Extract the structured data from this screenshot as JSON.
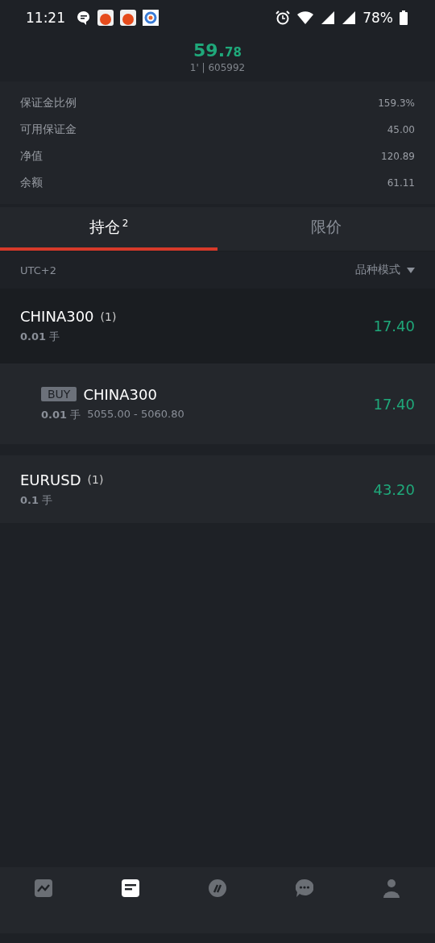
{
  "status_bar": {
    "time": "11:21",
    "battery": "78%"
  },
  "header": {
    "balance_whole": "59.",
    "balance_fraction": "78",
    "account": "1' | 605992"
  },
  "summary": [
    {
      "label": "保证金比例",
      "value": "159.3%"
    },
    {
      "label": "可用保证金",
      "value": "45.00"
    },
    {
      "label": "净值",
      "value": "120.89"
    },
    {
      "label": "余额",
      "value": "61.11"
    }
  ],
  "tabs": [
    {
      "label": "持仓",
      "count": "2",
      "selected": true
    },
    {
      "label": "限价",
      "selected": false
    }
  ],
  "toolbar": {
    "timezone": "UTC+2",
    "mode": "品种模式"
  },
  "positions": [
    {
      "kind": "group",
      "symbol": "CHINA300",
      "count": "(1)",
      "lots": "0.01",
      "unit": "手",
      "profit": "17.40"
    },
    {
      "kind": "order",
      "side": "BUY",
      "symbol": "CHINA300",
      "lots": "0.01",
      "unit": "手",
      "range": "5055.00 - 5060.80",
      "profit": "17.40"
    },
    {
      "kind": "group",
      "symbol": "EURUSD",
      "count": "(1)",
      "lots": "0.1",
      "unit": "手",
      "profit": "43.20"
    }
  ],
  "bottom_nav": [
    {
      "kind": "chart",
      "selected": false
    },
    {
      "kind": "orders",
      "selected": true
    },
    {
      "kind": "slash",
      "selected": false
    },
    {
      "kind": "chat",
      "selected": false
    },
    {
      "kind": "person",
      "selected": false
    }
  ]
}
